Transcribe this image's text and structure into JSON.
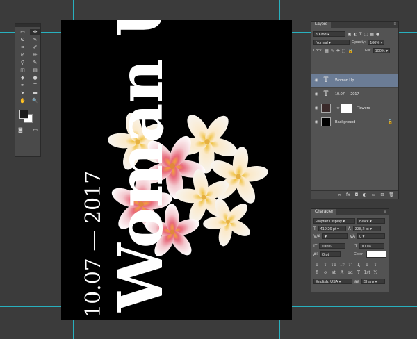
{
  "layers_panel": {
    "tab": "Layers",
    "filter_kind": "Kind",
    "blend_mode": "Normal",
    "opacity_label": "Opacity:",
    "opacity_value": "100%",
    "lock_label": "Lock:",
    "fill_label": "Fill:",
    "fill_value": "100%",
    "layers": [
      {
        "name": "Woman Up",
        "type": "text",
        "selected": true
      },
      {
        "name": "10.07 — 2017",
        "type": "text",
        "selected": false
      },
      {
        "name": "Flowers",
        "type": "image",
        "selected": false
      },
      {
        "name": "Background",
        "type": "background",
        "selected": false,
        "locked": true
      }
    ],
    "footer_icons": [
      "link-icon",
      "fx-icon",
      "mask-icon",
      "adjustment-icon",
      "folder-icon",
      "new-layer-icon",
      "trash-icon"
    ]
  },
  "character_panel": {
    "tab": "Character",
    "font_family": "Playfair Display",
    "font_style": "Black",
    "font_size": "419,26 pt",
    "leading": "338,2 pt",
    "kerning": "",
    "tracking": "0",
    "vertical_scale": "100%",
    "horizontal_scale": "100%",
    "baseline_shift": "0 pt",
    "color_label": "Color:",
    "language": "English: USA",
    "antialias": "Sharp",
    "style_buttons": [
      "T",
      "T",
      "TT",
      "Tr",
      "T'",
      "T,",
      "T",
      "T"
    ],
    "opentype_buttons": [
      "fi",
      "ơ",
      "st",
      "A",
      "ad",
      "T",
      "1st",
      "½"
    ]
  },
  "canvas": {
    "title_text": "Woman Up",
    "date_text": "10.07 — 2017",
    "background": "#000000"
  },
  "tools": [
    {
      "icon": "move-icon",
      "glyph": "▭"
    },
    {
      "icon": "move-tool-icon",
      "glyph": "✥"
    },
    {
      "icon": "lasso-icon",
      "glyph": "ʘ"
    },
    {
      "icon": "magic-wand-icon",
      "glyph": "✎"
    },
    {
      "icon": "crop-icon",
      "glyph": "⌗"
    },
    {
      "icon": "eyedropper-icon",
      "glyph": "✐"
    },
    {
      "icon": "healing-icon",
      "glyph": "⊘"
    },
    {
      "icon": "brush-icon",
      "glyph": "✏"
    },
    {
      "icon": "stamp-icon",
      "glyph": "⚲"
    },
    {
      "icon": "history-brush-icon",
      "glyph": "✎"
    },
    {
      "icon": "eraser-icon",
      "glyph": "◫"
    },
    {
      "icon": "gradient-icon",
      "glyph": "▤"
    },
    {
      "icon": "blur-icon",
      "glyph": "◆"
    },
    {
      "icon": "dodge-icon",
      "glyph": "●"
    },
    {
      "icon": "pen-icon",
      "glyph": "✒"
    },
    {
      "icon": "type-icon",
      "glyph": "T"
    },
    {
      "icon": "path-select-icon",
      "glyph": "➤"
    },
    {
      "icon": "rectangle-icon",
      "glyph": "▬"
    },
    {
      "icon": "hand-icon",
      "glyph": "✋"
    },
    {
      "icon": "zoom-icon",
      "glyph": "🔍"
    }
  ],
  "colors": {
    "accent": "#6b7c95",
    "guide": "#26c5d6",
    "panel": "#535353"
  }
}
